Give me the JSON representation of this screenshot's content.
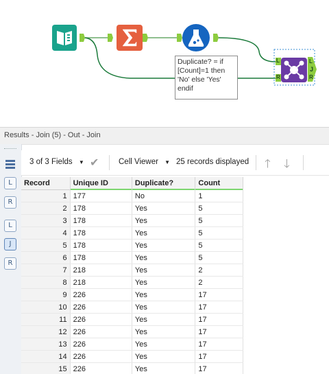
{
  "canvas": {
    "formula_text": "Duplicate? = if\n[Count]=1 then\n'No' else 'Yes'\nendif",
    "join_anchor_in_left": "L",
    "join_anchor_in_right": "R",
    "join_anchor_out_left": "L",
    "join_anchor_out_join": "J",
    "join_anchor_out_right": "R",
    "colors": {
      "input_tool": "#1aa38c",
      "summarize_tool": "#e5603f",
      "formula_tool": "#1565c0",
      "join_tool": "#6a3ba4",
      "connection": "#1a7a3a"
    }
  },
  "results": {
    "title": "Results - Join (5) - Out - Join",
    "rail": {
      "list_icon": "list-icon",
      "left": "L",
      "right": "R",
      "j": "J"
    },
    "toolbar": {
      "fields_label": "3 of 3 Fields",
      "cell_viewer_label": "Cell Viewer",
      "records_displayed": "25 records displayed"
    },
    "columns": [
      "Record",
      "Unique ID",
      "Duplicate?",
      "Count"
    ],
    "rows": [
      [
        "1",
        "177",
        "No",
        "1"
      ],
      [
        "2",
        "178",
        "Yes",
        "5"
      ],
      [
        "3",
        "178",
        "Yes",
        "5"
      ],
      [
        "4",
        "178",
        "Yes",
        "5"
      ],
      [
        "5",
        "178",
        "Yes",
        "5"
      ],
      [
        "6",
        "178",
        "Yes",
        "5"
      ],
      [
        "7",
        "218",
        "Yes",
        "2"
      ],
      [
        "8",
        "218",
        "Yes",
        "2"
      ],
      [
        "9",
        "226",
        "Yes",
        "17"
      ],
      [
        "10",
        "226",
        "Yes",
        "17"
      ],
      [
        "11",
        "226",
        "Yes",
        "17"
      ],
      [
        "12",
        "226",
        "Yes",
        "17"
      ],
      [
        "13",
        "226",
        "Yes",
        "17"
      ],
      [
        "14",
        "226",
        "Yes",
        "17"
      ],
      [
        "15",
        "226",
        "Yes",
        "17"
      ]
    ]
  }
}
